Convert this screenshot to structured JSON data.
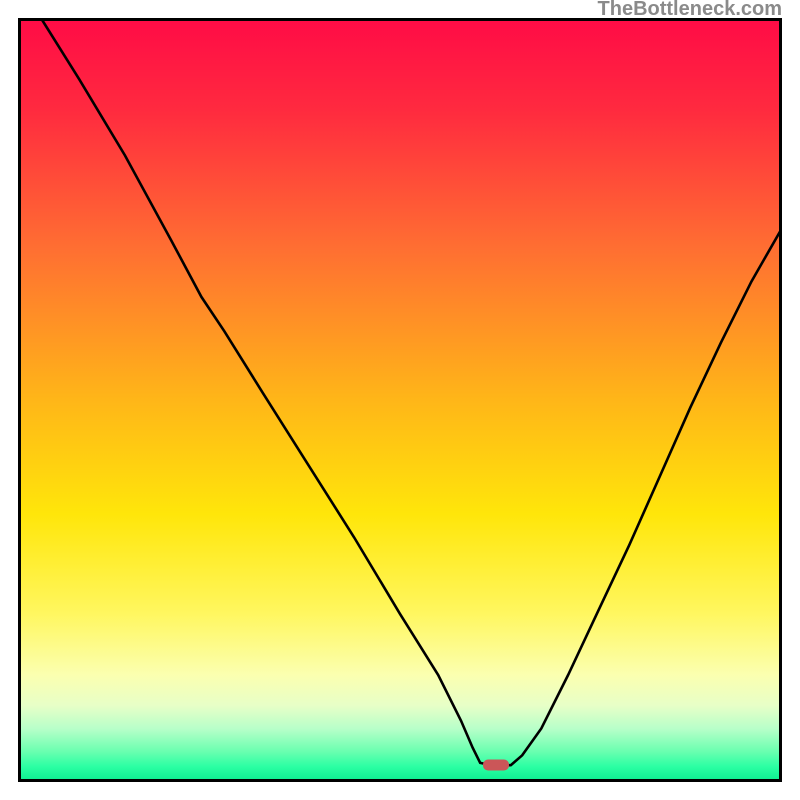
{
  "watermark": "TheBottleneck.com",
  "chart_data": {
    "type": "line",
    "title": "",
    "xlabel": "",
    "ylabel": "",
    "xlim": [
      0,
      100
    ],
    "ylim": [
      0,
      100
    ],
    "grid": false,
    "legend": false,
    "marker": {
      "x_pct": 62.5,
      "y_pct": 97.8,
      "color": "#cb5658"
    },
    "gradient_stops": [
      {
        "pct": 0,
        "color": "#ff0b46"
      },
      {
        "pct": 12,
        "color": "#ff2a3f"
      },
      {
        "pct": 30,
        "color": "#ff6e32"
      },
      {
        "pct": 50,
        "color": "#ffb618"
      },
      {
        "pct": 65,
        "color": "#ffe60a"
      },
      {
        "pct": 78,
        "color": "#fff760"
      },
      {
        "pct": 86,
        "color": "#fbffb0"
      },
      {
        "pct": 90,
        "color": "#e7ffc7"
      },
      {
        "pct": 93,
        "color": "#b8ffc9"
      },
      {
        "pct": 96,
        "color": "#6affb0"
      },
      {
        "pct": 98,
        "color": "#2bffa3"
      },
      {
        "pct": 100,
        "color": "#0aec8f"
      }
    ],
    "series": [
      {
        "name": "bottleneck-curve",
        "points_pct": [
          [
            3.0,
            0.0
          ],
          [
            8.0,
            8.0
          ],
          [
            14.0,
            18.0
          ],
          [
            20.0,
            29.0
          ],
          [
            24.0,
            36.5
          ],
          [
            27.0,
            41.0
          ],
          [
            32.0,
            49.0
          ],
          [
            38.0,
            58.5
          ],
          [
            44.0,
            68.0
          ],
          [
            50.0,
            78.0
          ],
          [
            55.0,
            86.0
          ],
          [
            58.0,
            92.0
          ],
          [
            59.5,
            95.5
          ],
          [
            60.5,
            97.5
          ],
          [
            62.0,
            97.8
          ],
          [
            64.5,
            97.8
          ],
          [
            66.0,
            96.5
          ],
          [
            68.5,
            93.0
          ],
          [
            72.0,
            86.0
          ],
          [
            76.0,
            77.5
          ],
          [
            80.0,
            69.0
          ],
          [
            84.0,
            60.0
          ],
          [
            88.0,
            51.0
          ],
          [
            92.0,
            42.5
          ],
          [
            96.0,
            34.5
          ],
          [
            100.0,
            27.5
          ]
        ]
      }
    ]
  }
}
